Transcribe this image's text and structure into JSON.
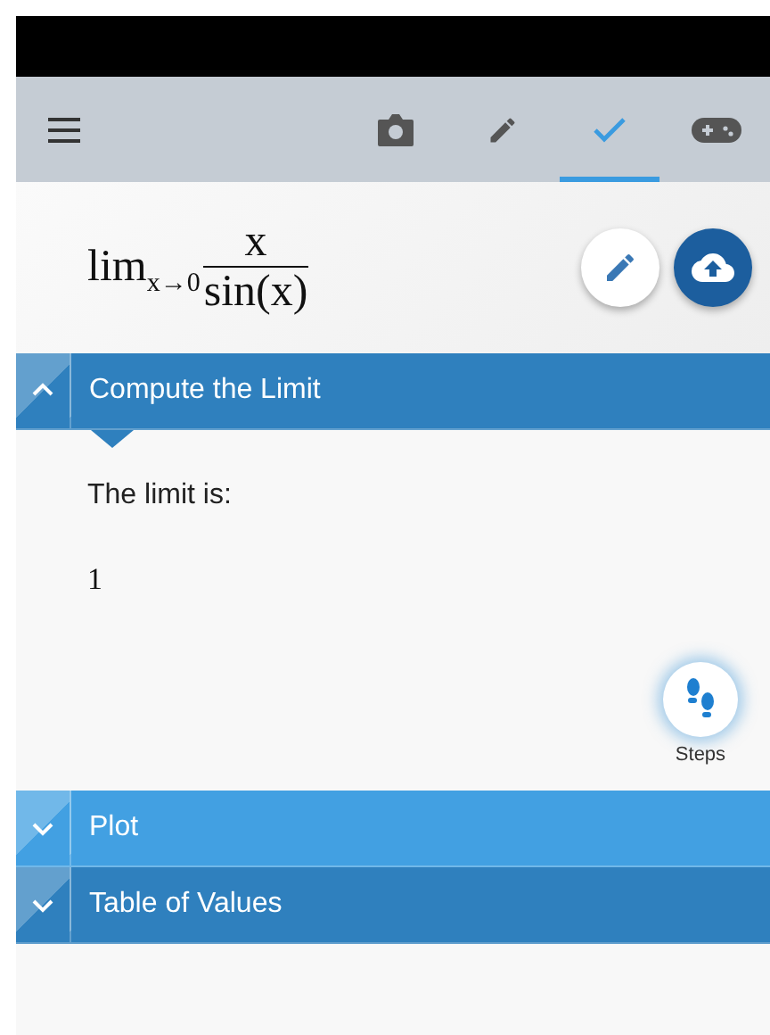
{
  "toolbar": {
    "tabs": [
      {
        "kind": "camera",
        "selected": false
      },
      {
        "kind": "pencil",
        "selected": false
      },
      {
        "kind": "check",
        "selected": true
      },
      {
        "kind": "gamepad",
        "selected": false
      }
    ]
  },
  "formula": {
    "operator": "lim",
    "subscript": "x→0",
    "numerator": "x",
    "denominator": "sin(x)"
  },
  "sections": [
    {
      "title": "Compute the Limit",
      "expanded": true,
      "color": "#2f80be",
      "lead": "The limit is:",
      "result": "1",
      "steps_label": "Steps"
    },
    {
      "title": "Plot",
      "expanded": false,
      "color": "#42a0e2"
    },
    {
      "title": "Table of Values",
      "expanded": false,
      "color": "#2f80be"
    }
  ]
}
